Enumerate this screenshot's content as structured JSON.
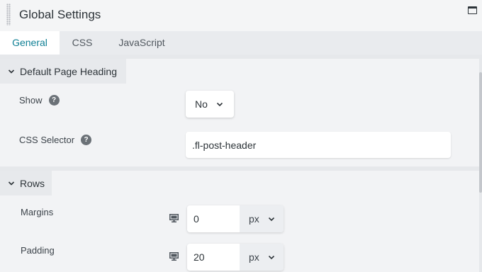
{
  "window": {
    "title": "Global Settings"
  },
  "tabs": [
    {
      "label": "General",
      "active": true
    },
    {
      "label": "CSS",
      "active": false
    },
    {
      "label": "JavaScript",
      "active": false
    }
  ],
  "sections": {
    "heading": {
      "title": "Default Page Heading",
      "show": {
        "label": "Show",
        "value": "No"
      },
      "css_selector": {
        "label": "CSS Selector",
        "value": ".fl-post-header"
      }
    },
    "rows": {
      "title": "Rows",
      "margins": {
        "label": "Margins",
        "value": "0",
        "unit": "px"
      },
      "padding": {
        "label": "Padding",
        "value": "20",
        "unit": "px"
      }
    }
  },
  "help_glyph": "?",
  "colors": {
    "accent": "#0e7f94",
    "help_icon": "#6b7177"
  }
}
